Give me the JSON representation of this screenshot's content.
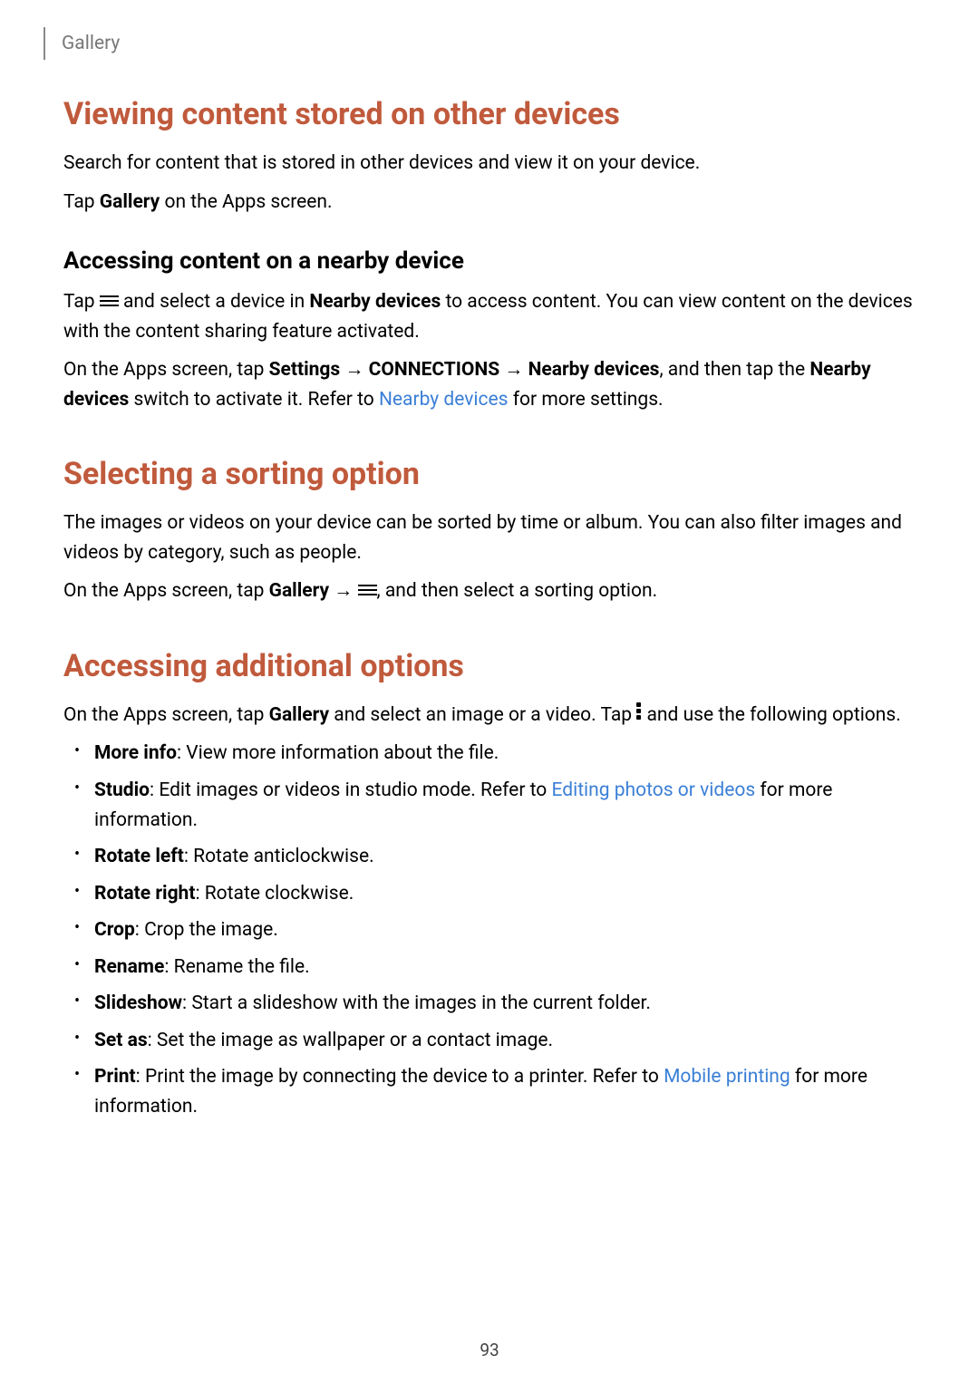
{
  "header": {
    "crumb": "Gallery"
  },
  "section1": {
    "title": "Viewing content stored on other devices",
    "p1": "Search for content that is stored in other devices and view it on your device.",
    "p2_pre": "Tap ",
    "p2_bold": "Gallery",
    "p2_post": " on the Apps screen.",
    "sub_title": "Accessing content on a nearby device",
    "sub_p1_a": "Tap ",
    "sub_p1_b": " and select a device in ",
    "sub_p1_bold": "Nearby devices",
    "sub_p1_c": " to access content. You can view content on the devices with the content sharing feature activated.",
    "sub_p2_a": "On the Apps screen, tap ",
    "sub_p2_b1": "Settings",
    "sub_p2_arrow1": " → ",
    "sub_p2_b2": "CONNECTIONS",
    "sub_p2_arrow2": " → ",
    "sub_p2_b3": "Nearby devices",
    "sub_p2_c": ", and then tap the ",
    "sub_p2_b4": "Nearby devices",
    "sub_p2_d": " switch to activate it. Refer to ",
    "sub_p2_link": "Nearby devices",
    "sub_p2_e": " for more settings."
  },
  "section2": {
    "title": "Selecting a sorting option",
    "p1": "The images or videos on your device can be sorted by time or album. You can also filter images and videos by category, such as people.",
    "p2_a": "On the Apps screen, tap ",
    "p2_b": "Gallery",
    "p2_arrow": " → ",
    "p2_c": ", and then select a sorting option."
  },
  "section3": {
    "title": "Accessing additional options",
    "p1_a": "On the Apps screen, tap ",
    "p1_b": "Gallery",
    "p1_c": " and select an image or a video. Tap ",
    "p1_d": " and use the following options.",
    "items": [
      {
        "bold": "More info",
        "rest": ": View more information about the file."
      },
      {
        "bold": "Studio",
        "rest_a": ": Edit images or videos in studio mode. Refer to ",
        "link": "Editing photos or videos",
        "rest_b": " for more information."
      },
      {
        "bold": "Rotate left",
        "rest": ": Rotate anticlockwise."
      },
      {
        "bold": "Rotate right",
        "rest": ": Rotate clockwise."
      },
      {
        "bold": "Crop",
        "rest": ": Crop the image."
      },
      {
        "bold": "Rename",
        "rest": ": Rename the file."
      },
      {
        "bold": "Slideshow",
        "rest": ": Start a slideshow with the images in the current folder."
      },
      {
        "bold": "Set as",
        "rest": ": Set the image as wallpaper or a contact image."
      },
      {
        "bold": "Print",
        "rest_a": ": Print the image by connecting the device to a printer. Refer to ",
        "link": "Mobile printing",
        "rest_b": " for more information."
      }
    ]
  },
  "page_number": "93"
}
